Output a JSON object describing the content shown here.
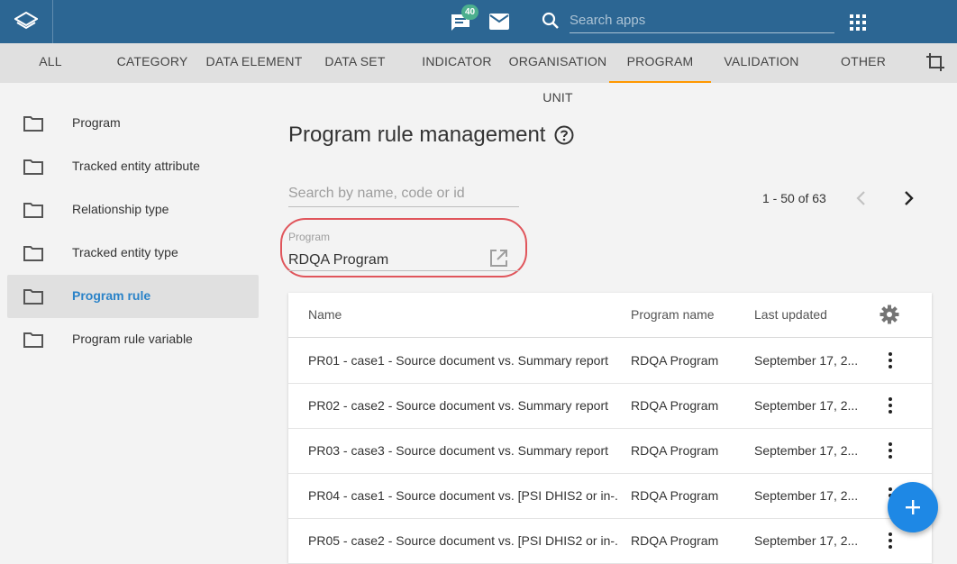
{
  "header": {
    "notifications_count": "40",
    "search_placeholder": "Search apps",
    "icons": [
      "dhis2-logo-icon",
      "chat-icon",
      "mail-icon",
      "search-icon",
      "apps-grid-icon"
    ]
  },
  "tabs": [
    {
      "label": "ALL"
    },
    {
      "label": "CATEGORY"
    },
    {
      "label": "DATA ELEMENT"
    },
    {
      "label": "DATA SET"
    },
    {
      "label": "INDICATOR"
    },
    {
      "label": "ORGANISATION UNIT"
    },
    {
      "label": "PROGRAM",
      "active": true
    },
    {
      "label": "VALIDATION"
    },
    {
      "label": "OTHER"
    }
  ],
  "sidebar": {
    "items": [
      {
        "label": "Program"
      },
      {
        "label": "Tracked entity attribute"
      },
      {
        "label": "Relationship type"
      },
      {
        "label": "Tracked entity type"
      },
      {
        "label": "Program rule",
        "active": true
      },
      {
        "label": "Program rule variable"
      }
    ]
  },
  "main": {
    "title": "Program rule management",
    "search_placeholder": "Search by name, code or id",
    "pager": "1 - 50 of 63",
    "program_filter": {
      "label": "Program",
      "value": "RDQA Program"
    }
  },
  "table": {
    "columns": [
      "Name",
      "Program name",
      "Last updated"
    ],
    "rows": [
      {
        "name": "PR01 - case1 - Source document vs. Summary report",
        "program": "RDQA Program",
        "updated": "September 17, 2..."
      },
      {
        "name": "PR02 - case2 - Source document vs. Summary report",
        "program": "RDQA Program",
        "updated": "September 17, 2..."
      },
      {
        "name": "PR03 - case3 - Source document vs. Summary report",
        "program": "RDQA Program",
        "updated": "September 17, 2..."
      },
      {
        "name": "PR04 - case1 - Source document vs. [PSI DHIS2 or in-...",
        "program": "RDQA Program",
        "updated": "September 17, 2..."
      },
      {
        "name": "PR05 - case2 - Source document vs. [PSI DHIS2 or in-...",
        "program": "RDQA Program",
        "updated": "September 17, 2..."
      }
    ]
  },
  "colors": {
    "header_bg": "#2c6693",
    "active_tab_underline": "#ff9800",
    "active_sidebar_text": "#2b83c8",
    "highlight_circle": "#e0555b",
    "fab_bg": "#1e88e5"
  }
}
